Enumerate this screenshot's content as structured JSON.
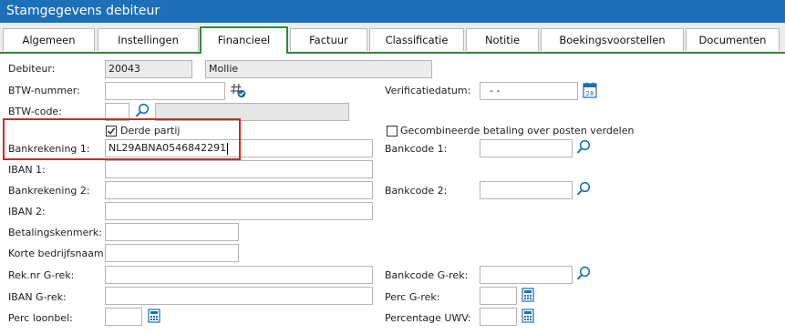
{
  "window": {
    "title": "Stamgegevens debiteur"
  },
  "tabs": [
    {
      "label": "Algemeen"
    },
    {
      "label": "Instellingen"
    },
    {
      "label": "Financieel"
    },
    {
      "label": "Factuur"
    },
    {
      "label": "Classificatie"
    },
    {
      "label": "Notitie"
    },
    {
      "label": "Boekingsvoorstellen"
    },
    {
      "label": "Documenten"
    }
  ],
  "active_tab": "Financieel",
  "form": {
    "debiteur": {
      "label": "Debiteur:",
      "code": "20043",
      "name": "Mollie"
    },
    "btw_nummer": {
      "label": "BTW-nummer:",
      "value": ""
    },
    "verificatiedatum": {
      "label": "Verificatiedatum:",
      "value": "-  -"
    },
    "btw_code": {
      "label": "BTW-code:",
      "value": "",
      "description": ""
    },
    "derde_partij": {
      "label": "Derde partij",
      "checked": true
    },
    "gecombineerde_betaling": {
      "label": "Gecombineerde betaling over posten verdelen",
      "checked": false
    },
    "bankrekening_1": {
      "label": "Bankrekening 1:",
      "value": "NL29ABNA0546842291"
    },
    "bankcode_1": {
      "label": "Bankcode 1:",
      "value": ""
    },
    "iban_1": {
      "label": "IBAN 1:",
      "value": ""
    },
    "bankrekening_2": {
      "label": "Bankrekening 2:",
      "value": ""
    },
    "bankcode_2": {
      "label": "Bankcode 2:",
      "value": ""
    },
    "iban_2": {
      "label": "IBAN 2:",
      "value": ""
    },
    "betalingskenmerk": {
      "label": "Betalingskenmerk:",
      "value": ""
    },
    "korte_bedrijfsnaam": {
      "label": "Korte bedrijfsnaam:",
      "value": ""
    },
    "reknr_grek": {
      "label": "Rek.nr G-rek:",
      "value": ""
    },
    "bankcode_grek": {
      "label": "Bankcode G-rek:",
      "value": ""
    },
    "iban_grek": {
      "label": "IBAN G-rek:",
      "value": ""
    },
    "perc_grek": {
      "label": "Perc G-rek:",
      "value": ""
    },
    "perc_loonbel": {
      "label": "Perc loonbel:",
      "value": ""
    },
    "percentage_uwv": {
      "label": "Percentage UWV:",
      "value": ""
    }
  },
  "colors": {
    "titlebar": "#1d6fb8",
    "active_tab_border": "#2e8b3d",
    "highlight": "#d9261c",
    "icon_blue": "#1f6fb2"
  },
  "icons": {
    "lookup": "magnifier-icon",
    "verify": "hash-check-icon",
    "date": "calendar-icon",
    "calc": "calculator-icon"
  }
}
